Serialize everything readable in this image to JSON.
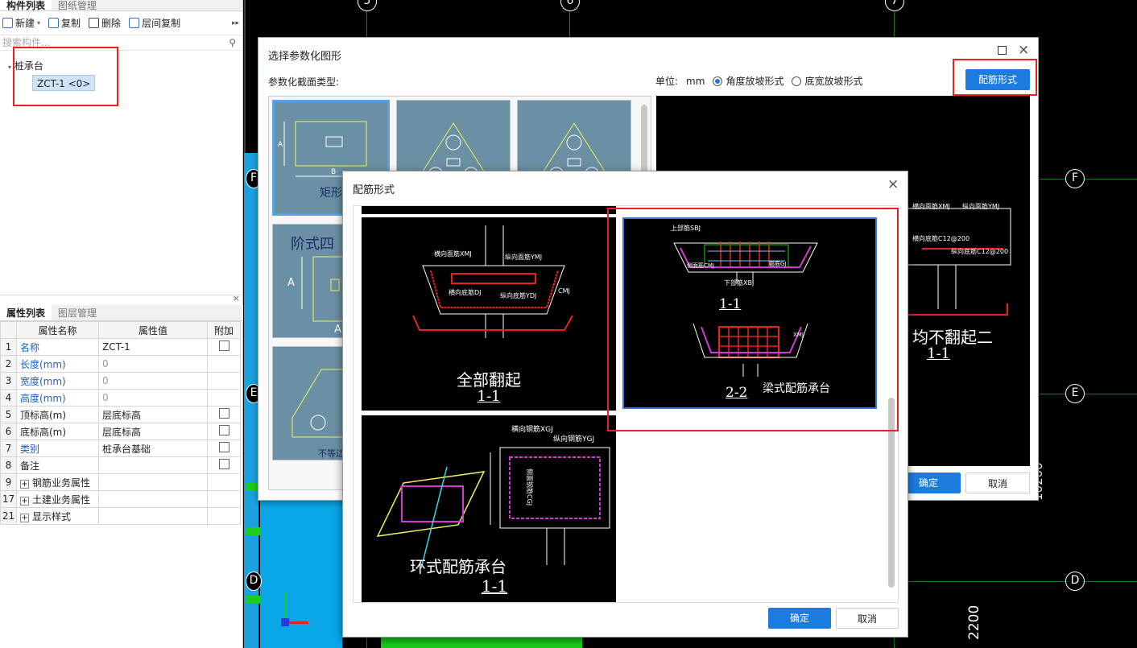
{
  "left_panel": {
    "tabs": [
      "构件列表",
      "图纸管理"
    ],
    "toolbar": {
      "new": "新建",
      "copy": "复制",
      "delete": "删除",
      "floor_copy": "层间复制"
    },
    "search_placeholder": "搜索构件...",
    "tree": {
      "group": "桩承台",
      "item": "ZCT-1 <0>"
    }
  },
  "props_panel": {
    "tabs": [
      "属性列表",
      "图层管理"
    ],
    "headers": [
      "属性名称",
      "属性值",
      "附加"
    ],
    "rows": [
      {
        "num": "1",
        "name": "名称",
        "value": "ZCT-1",
        "checkbox": true
      },
      {
        "num": "2",
        "name": "长度(mm)",
        "value": "0",
        "checkbox": false
      },
      {
        "num": "3",
        "name": "宽度(mm)",
        "value": "0",
        "checkbox": false
      },
      {
        "num": "4",
        "name": "高度(mm)",
        "value": "0",
        "checkbox": false
      },
      {
        "num": "5",
        "name": "顶标高(m)",
        "value": "层底标高",
        "checkbox": true
      },
      {
        "num": "6",
        "name": "底标高(m)",
        "value": "层底标高",
        "checkbox": true
      },
      {
        "num": "7",
        "name": "类别",
        "value": "桩承台基础",
        "checkbox": true
      },
      {
        "num": "8",
        "name": "备注",
        "value": "",
        "checkbox": true
      },
      {
        "num": "9",
        "name": "钢筋业务属性",
        "value": "",
        "group": true
      },
      {
        "num": "17",
        "name": "土建业务属性",
        "value": "",
        "group": true
      },
      {
        "num": "21",
        "name": "显示样式",
        "value": "",
        "group": true
      }
    ]
  },
  "cad": {
    "axis_labels": [
      "5",
      "6",
      "7",
      "F",
      "E",
      "D"
    ],
    "dimension": "2200",
    "dimension_side": "10200"
  },
  "dialog1": {
    "title": "选择参数化图形",
    "section_label": "参数化截面类型:",
    "unit_label": "单位:",
    "unit_value": "mm",
    "radio_angle": "角度放坡形式",
    "radio_width": "底宽放坡形式",
    "rebar_button": "配筋形式",
    "ok": "确定",
    "cancel": "取消",
    "thumbs": [
      "矩形",
      "阶式四",
      "不等边"
    ],
    "preview_caption": "均不翻起二",
    "preview_sub": "1-1",
    "preview_labels": [
      "横向面筋XMJ",
      "纵向面筋YMJ",
      "横向底筋C12@200",
      "纵向底筋C12@200"
    ]
  },
  "dialog2": {
    "title": "配筋形式",
    "ok": "确定",
    "cancel": "取消",
    "cell1": {
      "caption": "全部翻起",
      "section": "1-1",
      "labels": [
        "横向面筋XMJ",
        "纵向面筋YMJ",
        "横向底筋DJ",
        "纵向底筋YDJ",
        "CMJ"
      ]
    },
    "cell2": {
      "caption": "梁式配筋承台",
      "section1": "1-1",
      "section2": "2-2",
      "labels": [
        "上部筋SBJ",
        "侧面筋CMJ",
        "下部筋XBJ",
        "箍筋GJ",
        "XMJ"
      ]
    },
    "cell3": {
      "caption": "环式配筋承台",
      "section": "1-1",
      "labels": [
        "横向钢筋XGJ",
        "纵向钢筋YGJ",
        "侧面钢筋CGJ"
      ]
    }
  }
}
